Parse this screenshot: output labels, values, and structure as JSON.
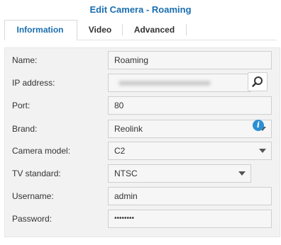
{
  "window": {
    "title": "Edit Camera - Roaming"
  },
  "tabs": [
    {
      "label": "Information",
      "active": true
    },
    {
      "label": "Video",
      "active": false
    },
    {
      "label": "Advanced",
      "active": false
    }
  ],
  "form": {
    "name": {
      "label": "Name:",
      "value": "Roaming"
    },
    "ip_address": {
      "label": "IP address:",
      "value": ""
    },
    "port": {
      "label": "Port:",
      "value": "80"
    },
    "brand": {
      "label": "Brand:",
      "value": "Reolink"
    },
    "camera_model": {
      "label": "Camera model:",
      "value": "C2"
    },
    "tv_standard": {
      "label": "TV standard:",
      "value": "NTSC"
    },
    "username": {
      "label": "Username:",
      "value": "admin"
    },
    "password": {
      "label": "Password:",
      "value": "••••••••"
    }
  },
  "icons": {
    "search": "search-icon",
    "info": "info-icon",
    "dropdown": "chevron-down-icon"
  },
  "colors": {
    "accent": "#1a6eb0",
    "info": "#2b8fd3"
  }
}
